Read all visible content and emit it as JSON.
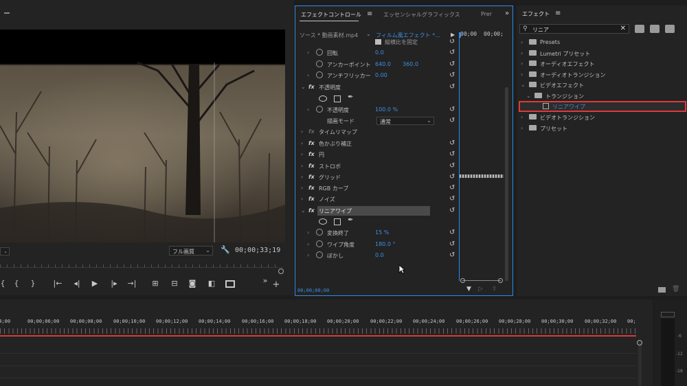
{
  "monitor": {
    "zoom_select": "フル画質",
    "timecode": "00;00;33;19"
  },
  "effect_controls": {
    "tabs": [
      "エフェクトコントロール",
      "エッセンシャルグラフィックス",
      "Prer"
    ],
    "source": "ソース * 動画素材.mp4",
    "clip": "フィルム風エフェクト *...",
    "ruler": [
      "00;00",
      "00;00;"
    ],
    "rows": {
      "uniform_scale": "縦横比を固定",
      "rotation_label": "回転",
      "rotation_value": "0.0",
      "anchor_label": "アンカーポイント",
      "anchor_x": "640.0",
      "anchor_y": "360.0",
      "antiflicker_label": "アンチフリッカー",
      "antiflicker_value": "0.00",
      "opacity_group": "不透明度",
      "opacity_label": "不透明度",
      "opacity_value": "100.0 %",
      "blend_label": "描画モード",
      "blend_value": "通常",
      "time_remap": "タイムリマップ",
      "fx1": "色かぶり補正",
      "fx2": "円",
      "fx3": "ストロボ",
      "fx4": "グリッド",
      "fx5": "RGB カーブ",
      "fx6": "ノイズ",
      "fx7": "リニアワイプ",
      "completion_label": "変換終了",
      "completion_value": "15 %",
      "angle_label": "ワイプ角度",
      "angle_value": "180.0 °",
      "feather_label": "ぼかし",
      "feather_value": "0.0"
    },
    "footer_time": "00;00;00;00"
  },
  "effects_panel": {
    "title": "エフェクト",
    "search_value": "リニア",
    "tree": {
      "presets": "Presets",
      "lumetri": "Lumetri プリセット",
      "audio_effects": "オーディオエフェクト",
      "audio_transitions": "オーディオトランジション",
      "video_effects": "ビデオエフェクト",
      "transition": "トランジション",
      "linear_wipe": "リニアワイプ",
      "video_transitions": "ビデオトランジション",
      "user_presets": "プリセット"
    }
  },
  "timeline": {
    "ruler": [
      "04;00",
      "00;00;06;00",
      "00;00;08;00",
      "00;00;10;00",
      "00;00;12;00",
      "00;00;14;00",
      "00;00;16;00",
      "00;00;18;00",
      "00;00;20;00",
      "00;00;22;00",
      "00;00;24;00",
      "00;00;26;00",
      "00;00;28;00",
      "00;00;30;00",
      "00;00;32;00",
      "00;"
    ]
  },
  "meter": {
    "labels": [
      "-6",
      "-12",
      "-18"
    ]
  },
  "colors": {
    "accent": "#2d8ceb",
    "value_blue": "#3d8fe0",
    "highlight": "#e03a3a",
    "playhead_red": "#d93b3b"
  }
}
